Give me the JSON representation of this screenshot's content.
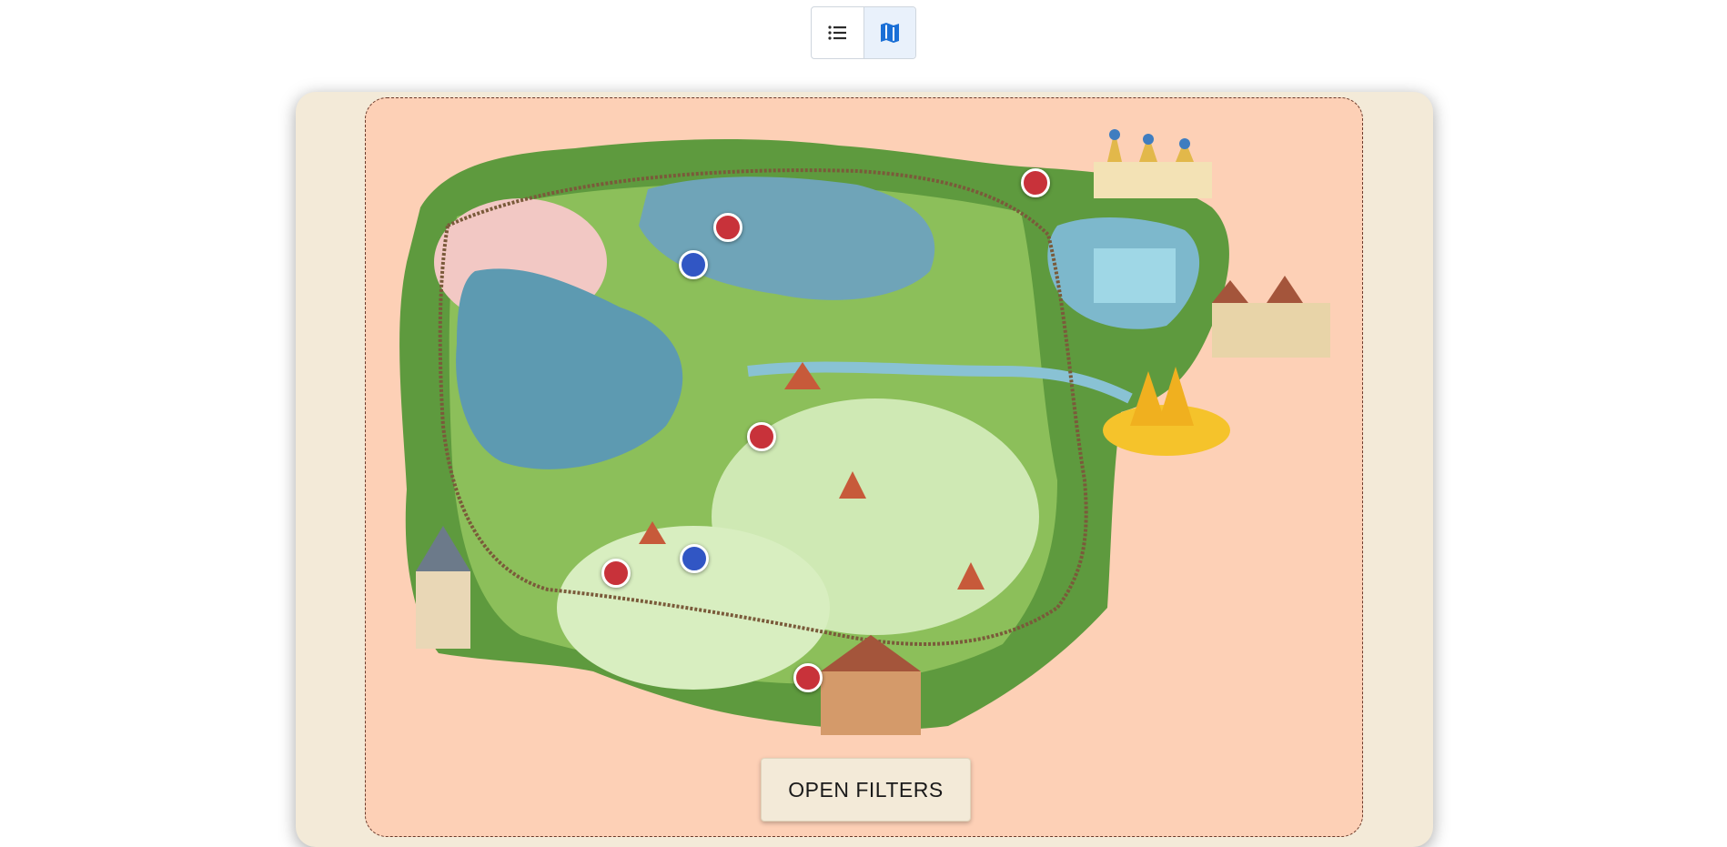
{
  "toolbar": {
    "list_view_icon": "list-icon",
    "map_view_icon": "map-icon",
    "active_view": "map",
    "accent_color": "#1a6fd6"
  },
  "map": {
    "background_color": "#fdd0b6",
    "card_color": "#f3ead8",
    "markers": [
      {
        "color": "red",
        "hex": "#c8323a"
      },
      {
        "color": "red",
        "hex": "#c8323a"
      },
      {
        "color": "blue",
        "hex": "#3156c4"
      },
      {
        "color": "red",
        "hex": "#c8323a"
      },
      {
        "color": "blue",
        "hex": "#3156c4"
      },
      {
        "color": "red",
        "hex": "#c8323a"
      },
      {
        "color": "red",
        "hex": "#c8323a"
      }
    ]
  },
  "filters_button": {
    "label": "OPEN FILTERS"
  }
}
